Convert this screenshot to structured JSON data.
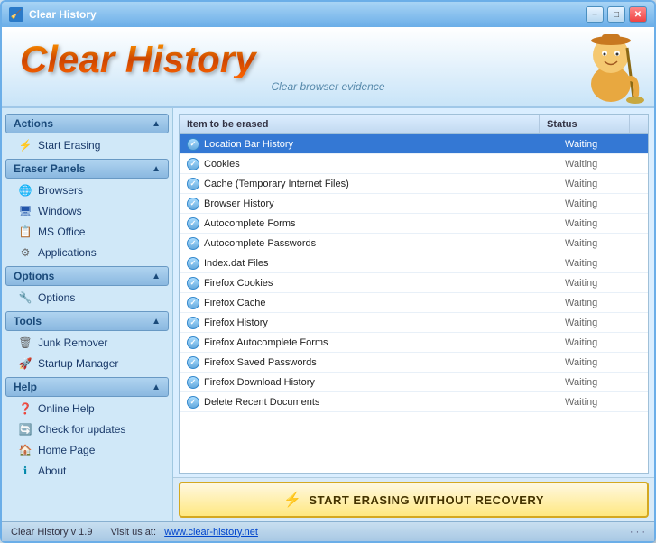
{
  "window": {
    "title": "Clear History",
    "buttons": {
      "minimize": "−",
      "maximize": "□",
      "close": "✕"
    }
  },
  "header": {
    "title": "Clear History",
    "subtitle": "Clear browser evidence"
  },
  "sidebar": {
    "sections": [
      {
        "id": "actions",
        "title": "Actions",
        "items": [
          {
            "id": "start-erasing",
            "label": "Start Erasing",
            "icon": "⚡",
            "iconClass": "icon-orange"
          }
        ]
      },
      {
        "id": "eraser-panels",
        "title": "Eraser Panels",
        "items": [
          {
            "id": "browsers",
            "label": "Browsers",
            "icon": "🌐",
            "iconClass": "icon-blue"
          },
          {
            "id": "windows",
            "label": "Windows",
            "icon": "🖥",
            "iconClass": "icon-blue"
          },
          {
            "id": "ms-office",
            "label": "MS Office",
            "icon": "📋",
            "iconClass": "icon-blue"
          },
          {
            "id": "applications",
            "label": "Applications",
            "icon": "⚙",
            "iconClass": "icon-gray"
          }
        ]
      },
      {
        "id": "options",
        "title": "Options",
        "items": [
          {
            "id": "options",
            "label": "Options",
            "icon": "🔧",
            "iconClass": "icon-orange"
          }
        ]
      },
      {
        "id": "tools",
        "title": "Tools",
        "items": [
          {
            "id": "junk-remover",
            "label": "Junk Remover",
            "icon": "🗑",
            "iconClass": "icon-gray"
          },
          {
            "id": "startup-manager",
            "label": "Startup Manager",
            "icon": "🚀",
            "iconClass": "icon-green"
          }
        ]
      },
      {
        "id": "help",
        "title": "Help",
        "items": [
          {
            "id": "online-help",
            "label": "Online Help",
            "icon": "❓",
            "iconClass": "icon-blue"
          },
          {
            "id": "check-updates",
            "label": "Check for updates",
            "icon": "🔄",
            "iconClass": "icon-green"
          },
          {
            "id": "home-page",
            "label": "Home Page",
            "icon": "🏠",
            "iconClass": "icon-green"
          },
          {
            "id": "about",
            "label": "About",
            "icon": "ℹ",
            "iconClass": "icon-cyan"
          }
        ]
      }
    ]
  },
  "table": {
    "columns": [
      {
        "id": "item",
        "label": "Item to be erased"
      },
      {
        "id": "status",
        "label": "Status"
      }
    ],
    "rows": [
      {
        "id": "location-bar",
        "item": "Location Bar History",
        "status": "Waiting",
        "selected": true
      },
      {
        "id": "cookies",
        "item": "Cookies",
        "status": "Waiting",
        "selected": false
      },
      {
        "id": "cache",
        "item": "Cache (Temporary Internet Files)",
        "status": "Waiting",
        "selected": false
      },
      {
        "id": "browser-history",
        "item": "Browser History",
        "status": "Waiting",
        "selected": false
      },
      {
        "id": "autocomplete-forms",
        "item": "Autocomplete Forms",
        "status": "Waiting",
        "selected": false
      },
      {
        "id": "autocomplete-passwords",
        "item": "Autocomplete Passwords",
        "status": "Waiting",
        "selected": false
      },
      {
        "id": "index-dat",
        "item": "Index.dat Files",
        "status": "Waiting",
        "selected": false
      },
      {
        "id": "firefox-cookies",
        "item": "Firefox Cookies",
        "status": "Waiting",
        "selected": false
      },
      {
        "id": "firefox-cache",
        "item": "Firefox Cache",
        "status": "Waiting",
        "selected": false
      },
      {
        "id": "firefox-history",
        "item": "Firefox History",
        "status": "Waiting",
        "selected": false
      },
      {
        "id": "firefox-autocomplete",
        "item": "Firefox Autocomplete Forms",
        "status": "Waiting",
        "selected": false
      },
      {
        "id": "firefox-passwords",
        "item": "Firefox Saved Passwords",
        "status": "Waiting",
        "selected": false
      },
      {
        "id": "firefox-download",
        "item": "Firefox Download History",
        "status": "Waiting",
        "selected": false
      },
      {
        "id": "recent-documents",
        "item": "Delete Recent Documents",
        "status": "Waiting",
        "selected": false
      }
    ]
  },
  "erase_button": {
    "label": "START ERASING WITHOUT RECOVERY"
  },
  "statusbar": {
    "version": "Clear History v 1.9",
    "visit_label": "Visit us at:",
    "website": "www.clear-history.net"
  }
}
